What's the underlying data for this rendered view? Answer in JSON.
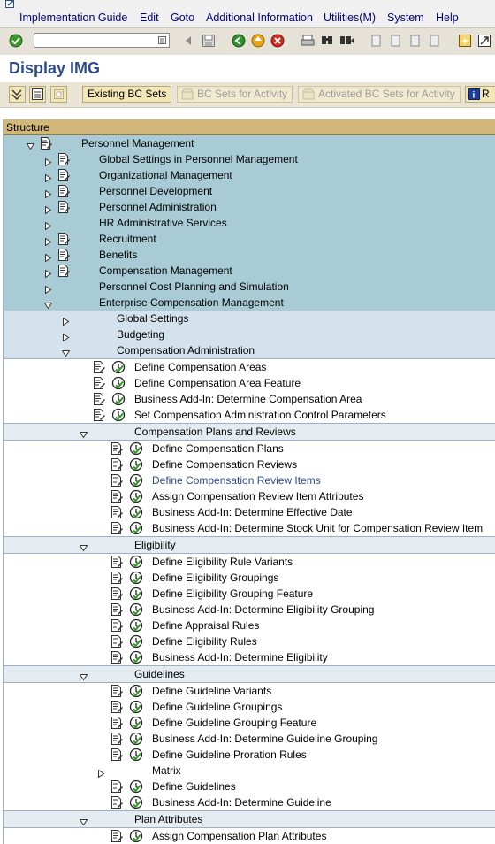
{
  "menu": [
    "Implementation Guide",
    "Edit",
    "Goto",
    "Additional Information",
    "Utilities(M)",
    "System",
    "Help"
  ],
  "title": "Display IMG",
  "buttons": {
    "existing_bc_sets": "Existing BC Sets",
    "bc_sets_activity": "BC Sets for Activity",
    "activated_bc_sets": "Activated BC Sets for Activity",
    "cut_label": "R"
  },
  "tree": {
    "header": "Structure",
    "rows": [
      {
        "label": "Personnel Management",
        "level": "l0",
        "toggle": "open",
        "doc": true,
        "clock": false
      },
      {
        "label": "Global Settings in Personnel Management",
        "level": "l1",
        "toggle": "closed",
        "doc": true,
        "clock": false
      },
      {
        "label": "Organizational Management",
        "level": "l1",
        "toggle": "closed",
        "doc": true,
        "clock": false
      },
      {
        "label": "Personnel Development",
        "level": "l1",
        "toggle": "closed",
        "doc": true,
        "clock": false
      },
      {
        "label": "Personnel Administration",
        "level": "l1",
        "toggle": "closed",
        "doc": true,
        "clock": false
      },
      {
        "label": "HR Administrative Services",
        "level": "l1",
        "toggle": "closed",
        "doc": false,
        "clock": false
      },
      {
        "label": "Recruitment",
        "level": "l1",
        "toggle": "closed",
        "doc": true,
        "clock": false
      },
      {
        "label": "Benefits",
        "level": "l1",
        "toggle": "closed",
        "doc": true,
        "clock": false
      },
      {
        "label": "Compensation Management",
        "level": "l1",
        "toggle": "closed",
        "doc": true,
        "clock": false
      },
      {
        "label": "Personnel Cost Planning and Simulation",
        "level": "l1",
        "toggle": "closed",
        "doc": false,
        "clock": false
      },
      {
        "label": "Enterprise Compensation Management",
        "level": "l1",
        "toggle": "open",
        "doc": false,
        "clock": false
      },
      {
        "label": "Global Settings",
        "level": "l2",
        "toggle": "closed",
        "doc": false,
        "clock": false
      },
      {
        "label": "Budgeting",
        "level": "l2",
        "toggle": "closed",
        "doc": false,
        "clock": false
      },
      {
        "label": "Compensation Administration",
        "level": "l2",
        "toggle": "open",
        "doc": false,
        "clock": false
      },
      {
        "label": "Define Compensation Areas",
        "level": "l3a",
        "toggle": "",
        "doc": true,
        "clock": true
      },
      {
        "label": "Define Compensation Area Feature",
        "level": "l3a",
        "toggle": "",
        "doc": true,
        "clock": true
      },
      {
        "label": "Business Add-In: Determine Compensation Area",
        "level": "l3a",
        "toggle": "",
        "doc": true,
        "clock": true
      },
      {
        "label": "Set Compensation Administration Control Parameters",
        "level": "l3a",
        "toggle": "",
        "doc": true,
        "clock": true
      },
      {
        "label": "Compensation Plans and Reviews",
        "level": "l3g",
        "toggle": "open",
        "doc": false,
        "clock": false
      },
      {
        "label": "Define Compensation Plans",
        "level": "l4",
        "toggle": "",
        "doc": true,
        "clock": true
      },
      {
        "label": "Define Compensation Reviews",
        "level": "l4",
        "toggle": "",
        "doc": true,
        "clock": true
      },
      {
        "label": "Define Compensation Review Items",
        "level": "l4",
        "toggle": "",
        "doc": true,
        "clock": true,
        "link": true
      },
      {
        "label": "Assign Compensation Review Item Attributes",
        "level": "l4",
        "toggle": "",
        "doc": true,
        "clock": true
      },
      {
        "label": "Business Add-In: Determine Effective Date",
        "level": "l4",
        "toggle": "",
        "doc": true,
        "clock": true
      },
      {
        "label": "Business Add-In: Determine Stock Unit for Compensation Review Item",
        "level": "l4",
        "toggle": "",
        "doc": true,
        "clock": true
      },
      {
        "label": "Eligibility",
        "level": "l3g",
        "toggle": "open",
        "doc": false,
        "clock": false
      },
      {
        "label": "Define Eligibility Rule Variants",
        "level": "l4",
        "toggle": "",
        "doc": true,
        "clock": true
      },
      {
        "label": "Define Eligibility Groupings",
        "level": "l4",
        "toggle": "",
        "doc": true,
        "clock": true
      },
      {
        "label": "Define Eligibility Grouping Feature",
        "level": "l4",
        "toggle": "",
        "doc": true,
        "clock": true
      },
      {
        "label": "Business Add-In: Determine Eligibility Grouping",
        "level": "l4",
        "toggle": "",
        "doc": true,
        "clock": true
      },
      {
        "label": "Define Appraisal Rules",
        "level": "l4",
        "toggle": "",
        "doc": true,
        "clock": true
      },
      {
        "label": "Define Eligibility Rules",
        "level": "l4",
        "toggle": "",
        "doc": true,
        "clock": true
      },
      {
        "label": "Business Add-In: Determine Eligibility",
        "level": "l4",
        "toggle": "",
        "doc": true,
        "clock": true
      },
      {
        "label": "Guidelines",
        "level": "l3g",
        "toggle": "open",
        "doc": false,
        "clock": false
      },
      {
        "label": "Define Guideline Variants",
        "level": "l4",
        "toggle": "",
        "doc": true,
        "clock": true
      },
      {
        "label": "Define Guideline Groupings",
        "level": "l4",
        "toggle": "",
        "doc": true,
        "clock": true
      },
      {
        "label": "Define Guideline Grouping Feature",
        "level": "l4",
        "toggle": "",
        "doc": true,
        "clock": true
      },
      {
        "label": "Business Add-In: Determine Guideline Grouping",
        "level": "l4",
        "toggle": "",
        "doc": true,
        "clock": true
      },
      {
        "label": "Define Guideline Proration Rules",
        "level": "l4",
        "toggle": "",
        "doc": true,
        "clock": true
      },
      {
        "label": "Matrix",
        "level": "l4m",
        "toggle": "closed",
        "doc": false,
        "clock": false
      },
      {
        "label": "Define Guidelines",
        "level": "l4",
        "toggle": "",
        "doc": true,
        "clock": true
      },
      {
        "label": "Business Add-In: Determine Guideline",
        "level": "l4",
        "toggle": "",
        "doc": true,
        "clock": true
      },
      {
        "label": "Plan Attributes",
        "level": "l3g",
        "toggle": "open",
        "doc": false,
        "clock": false
      },
      {
        "label": "Assign Compensation Plan Attributes",
        "level": "l4",
        "toggle": "",
        "doc": true,
        "clock": true
      }
    ]
  }
}
